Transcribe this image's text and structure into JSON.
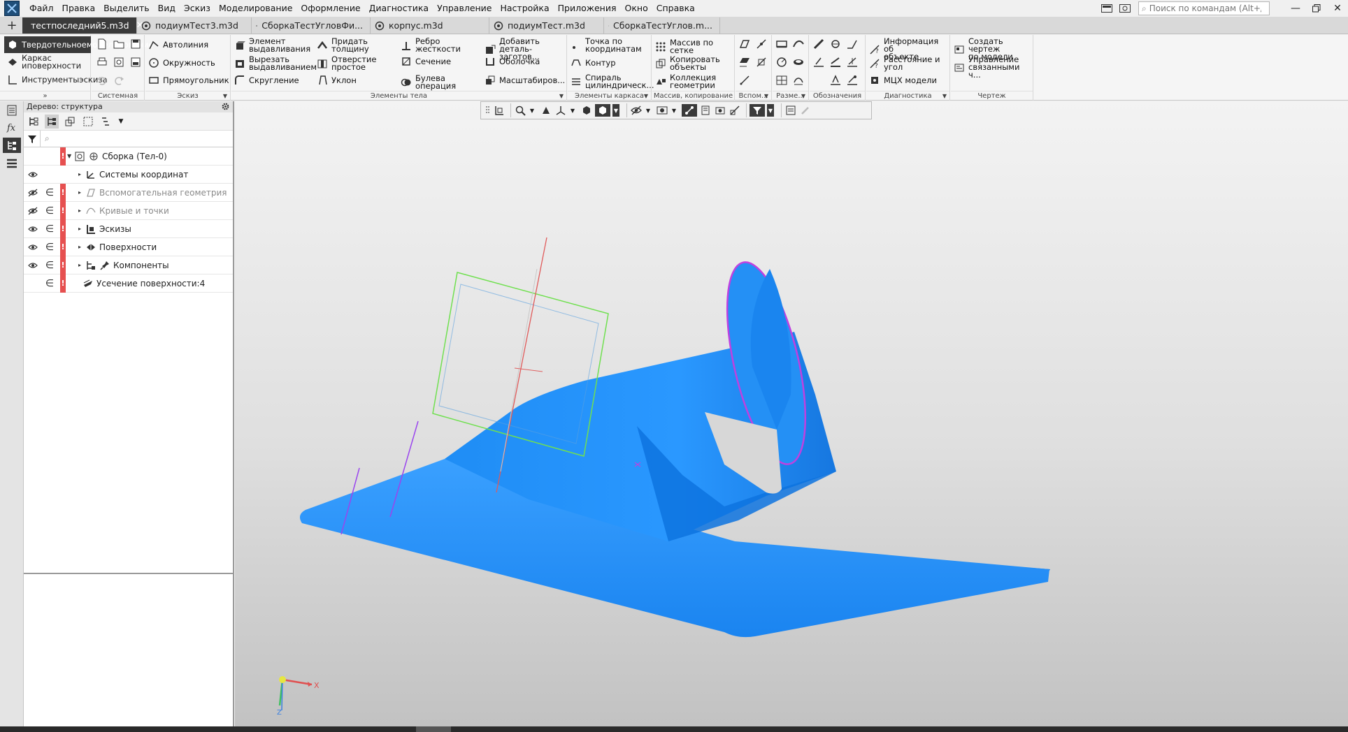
{
  "menu": {
    "items": [
      "Файл",
      "Правка",
      "Выделить",
      "Вид",
      "Эскиз",
      "Моделирование",
      "Оформление",
      "Диагностика",
      "Управление",
      "Настройка",
      "Приложения",
      "Окно",
      "Справка"
    ],
    "search_placeholder": "Поиск по командам (Alt+/)"
  },
  "tabs": [
    {
      "label": "тестпоследний5.m3d",
      "active": true
    },
    {
      "label": "подиумТест3.m3d",
      "active": false
    },
    {
      "label": "СборкаТестУгловФи...",
      "active": false
    },
    {
      "label": "корпус.m3d",
      "active": false
    },
    {
      "label": "подиумТест.m3d",
      "active": false
    },
    {
      "label": "СборкаТестУглов.m...",
      "active": false
    }
  ],
  "ribbon": {
    "modes": [
      {
        "l1": "Твердотельное",
        "l2": "моделирование",
        "active": true
      },
      {
        "l1": "Каркас и",
        "l2": "поверхности",
        "active": false
      },
      {
        "l1": "Инструменты",
        "l2": "эскиза",
        "active": false
      }
    ],
    "groups": {
      "system": "Системная",
      "sketch": "Эскиз",
      "body": "Элементы тела",
      "frame": "Элементы каркаса",
      "array": "Массив, копирование",
      "aux": "Вспом...",
      "dims": "Разме...",
      "marks": "Обозначения",
      "diag": "Диагностика",
      "drawing": "Чертеж"
    },
    "sketch_buttons": [
      "Автолиния",
      "Окружность",
      "Прямоугольник"
    ],
    "body_buttons": {
      "extrude": [
        "Элемент",
        "выдавливания"
      ],
      "cut": [
        "Вырезать",
        "выдавливанием"
      ],
      "fillet": "Скругление",
      "thicken": [
        "Придать",
        "толщину"
      ],
      "hole": [
        "Отверстие",
        "простое"
      ],
      "draft": "Уклон",
      "rib": [
        "Ребро",
        "жесткости"
      ],
      "section": "Сечение",
      "boolean": [
        "Булева",
        "операция"
      ],
      "add_blank": [
        "Добавить",
        "деталь-заготов..."
      ],
      "shell": "Оболочка",
      "scale": "Масштабиров..."
    },
    "frame_buttons": {
      "point": [
        "Точка по",
        "координатам"
      ],
      "contour": "Контур",
      "spiral": [
        "Спираль",
        "цилиндрическ..."
      ]
    },
    "array_buttons": {
      "grid": "Массив по сетке",
      "copy": [
        "Копировать",
        "объекты"
      ],
      "collection": [
        "Коллекция",
        "геометрии"
      ]
    },
    "diag_buttons": {
      "info": [
        "Информация об",
        "объекте"
      ],
      "distance": [
        "Расстояние и",
        "угол"
      ],
      "mcc": "МЦХ модели"
    },
    "drawing_buttons": {
      "create": [
        "Создать чертеж",
        "по модели"
      ],
      "manage": [
        "Управление",
        "связанными ч..."
      ]
    }
  },
  "tree": {
    "header": "Дерево: структура",
    "rows": [
      {
        "label": "Сборка (Тел-0)",
        "eye": "",
        "include": "",
        "error": true,
        "dim": false,
        "indent": 0
      },
      {
        "label": "Системы координат",
        "eye": "show",
        "include": "",
        "error": false,
        "dim": false,
        "indent": 1
      },
      {
        "label": "Вспомогательная геометрия",
        "eye": "hidden",
        "include": "∈",
        "error": true,
        "dim": true,
        "indent": 1
      },
      {
        "label": "Кривые и точки",
        "eye": "hidden",
        "include": "∈",
        "error": true,
        "dim": true,
        "indent": 1
      },
      {
        "label": "Эскизы",
        "eye": "show",
        "include": "∈",
        "error": true,
        "dim": false,
        "indent": 1
      },
      {
        "label": "Поверхности",
        "eye": "show",
        "include": "∈",
        "error": true,
        "dim": false,
        "indent": 1
      },
      {
        "label": "Компоненты",
        "eye": "show",
        "include": "∈",
        "error": true,
        "dim": false,
        "indent": 1
      },
      {
        "label": "Усечение поверхности:4",
        "eye": "",
        "include": "∈",
        "error": true,
        "dim": false,
        "indent": 0
      }
    ]
  },
  "triad": {
    "x": "X",
    "z": "Z"
  },
  "colors": {
    "model_fill": "#1a8cff",
    "model_dark": "#0a6ee0",
    "active_tab": "#3a3a3a",
    "error_marker": "#e65050",
    "edge_magenta": "#c040e0",
    "plane_green": "#70e050"
  }
}
